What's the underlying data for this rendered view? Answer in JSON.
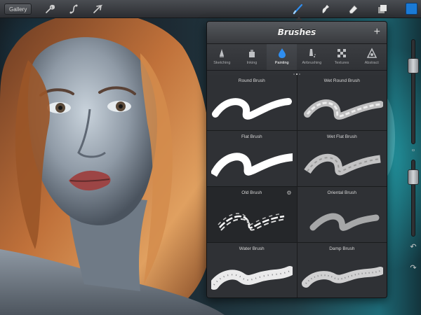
{
  "toolbar": {
    "gallery_label": "Gallery",
    "icons": [
      "wrench-icon",
      "curve-icon",
      "arrow-icon",
      "brush-icon",
      "smudge-icon",
      "eraser-icon",
      "layers-icon"
    ],
    "active_tool": "brush",
    "current_color": "#1a7ad6"
  },
  "brushes_panel": {
    "title": "Brushes",
    "add_label": "+",
    "categories": [
      {
        "label": "Sketching",
        "icon": "pencil-icon"
      },
      {
        "label": "Inking",
        "icon": "ink-icon"
      },
      {
        "label": "Painting",
        "icon": "drop-icon",
        "active": true
      },
      {
        "label": "Airbrushing",
        "icon": "airbrush-icon"
      },
      {
        "label": "Textures",
        "icon": "texture-icon"
      },
      {
        "label": "Abstract",
        "icon": "abstract-icon"
      }
    ],
    "page_count": 3,
    "current_page": 2,
    "brushes": [
      {
        "label": "Round Brush",
        "style": "solid"
      },
      {
        "label": "Wet Round Brush",
        "style": "wet"
      },
      {
        "label": "Flat Brush",
        "style": "solid"
      },
      {
        "label": "Wet Flat Brush",
        "style": "wet"
      },
      {
        "label": "Old Brush",
        "style": "dry",
        "selected": true
      },
      {
        "label": "Oriental Brush",
        "style": "soft"
      },
      {
        "label": "Water Brush",
        "style": "grain"
      },
      {
        "label": "Damp Brush",
        "style": "grain"
      }
    ]
  },
  "sidebar": {
    "size_slider_level": 0.2,
    "opacity_slider_level": 0.15,
    "undo_label": "↶",
    "redo_label": "↷"
  },
  "accent_color": "#2f8ef0"
}
